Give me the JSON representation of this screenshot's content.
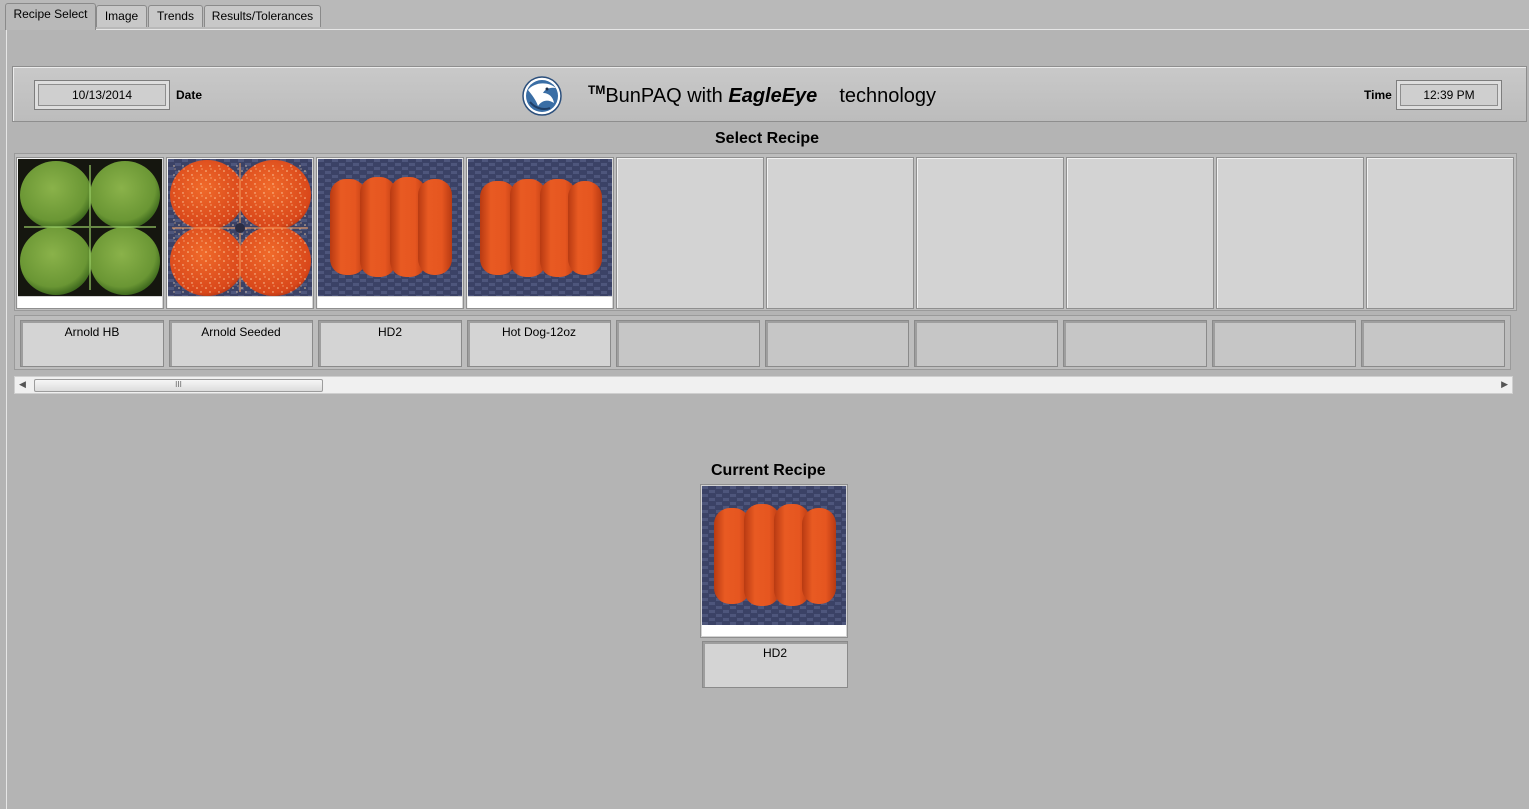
{
  "tabs": [
    {
      "label": "Recipe Select",
      "active": true
    },
    {
      "label": "Image",
      "active": false
    },
    {
      "label": "Trends",
      "active": false
    },
    {
      "label": "Results/Tolerances",
      "active": false
    }
  ],
  "header": {
    "date_value": "10/13/2014",
    "date_label": "Date",
    "time_label": "Time",
    "time_value": "12:39 PM",
    "brand": {
      "tm": "TM",
      "product": "BunPAQ with ",
      "eagle": "EagleEye",
      "tech": "technology"
    }
  },
  "selector": {
    "title": "Select Recipe",
    "recipes": [
      {
        "name": "Arnold HB",
        "image": "hamburger-buns-plain"
      },
      {
        "name": "Arnold Seeded",
        "image": "hamburger-buns-seeded"
      },
      {
        "name": "HD2",
        "image": "hot-dog-buns"
      },
      {
        "name": "Hot Dog-12oz",
        "image": "hot-dog-buns"
      },
      {
        "name": "",
        "image": ""
      },
      {
        "name": "",
        "image": ""
      },
      {
        "name": "",
        "image": ""
      },
      {
        "name": "",
        "image": ""
      },
      {
        "name": "",
        "image": ""
      },
      {
        "name": "",
        "image": ""
      }
    ],
    "scroll_grip": "III"
  },
  "current": {
    "title": "Current Recipe",
    "name": "HD2",
    "image": "hot-dog-buns"
  },
  "colors": {
    "background": "#b4b4b4",
    "panel": "#d3d3d3",
    "bun_orange": "#e2501a",
    "bun_green": "#6e9a38",
    "tray_blue": "#3c4468"
  }
}
